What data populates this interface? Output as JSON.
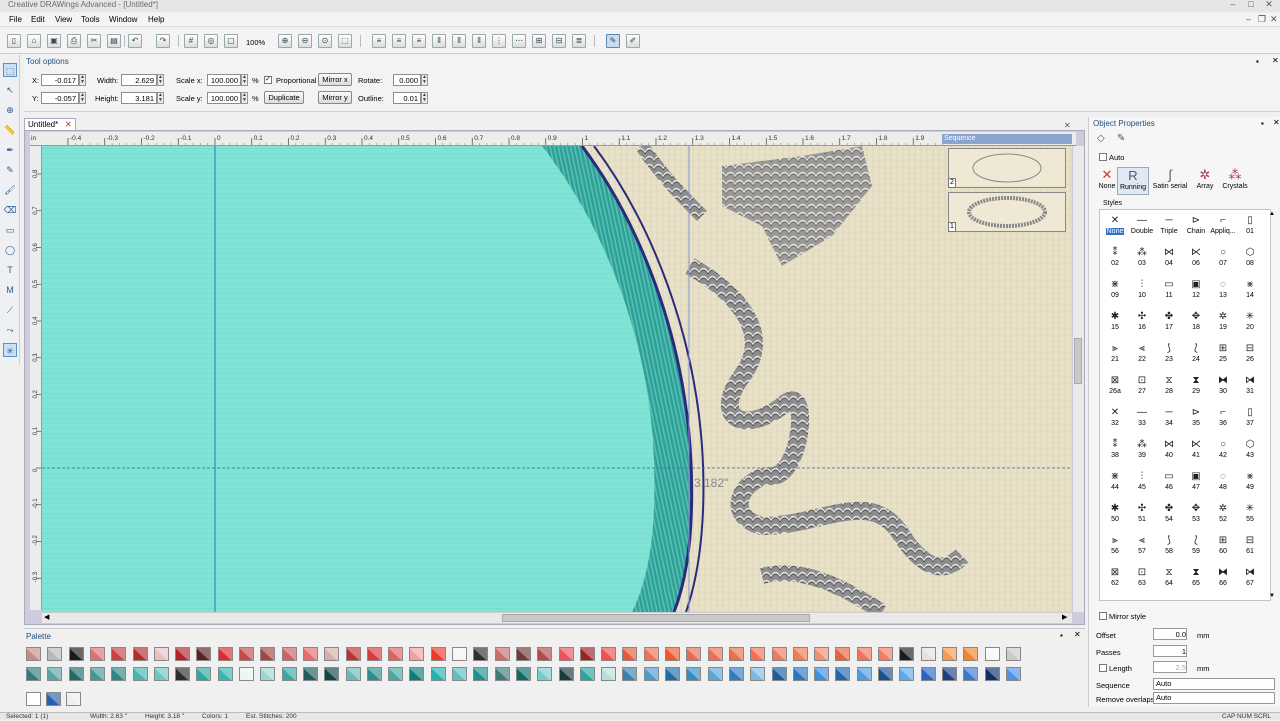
{
  "window": {
    "title": "Creative DRAWings Advanced - [Untitled*]"
  },
  "menu": [
    "File",
    "Edit",
    "View",
    "Tools",
    "Window",
    "Help"
  ],
  "toolbar": {
    "zoom": "100%"
  },
  "tool_options": {
    "header": "Tool options",
    "x_label": "X:",
    "x_value": "-0.017",
    "y_label": "Y:",
    "y_value": "-0.057",
    "width_label": "Width:",
    "width_value": "2.629",
    "height_label": "Height:",
    "height_value": "3.181",
    "scalex_label": "Scale x:",
    "scalex_value": "100.000",
    "scaley_label": "Scale y:",
    "scaley_value": "100.000",
    "percent": "%",
    "proportional_label": "Proportional",
    "duplicate_label": "Duplicate",
    "mirrorx_label": "Mirror x",
    "mirrory_label": "Mirror y",
    "rotate_label": "Rotate:",
    "rotate_value": "0.000",
    "outline_label": "Outline:",
    "outline_value": "0.01"
  },
  "document": {
    "tab_label": "Untitled*",
    "measure_label": "3.182\""
  },
  "ruler": {
    "unit": "in",
    "h_ticks": [
      "-0.4",
      "-0.3",
      "-0.2",
      "-0.1",
      "0",
      "0.1",
      "0.2",
      "0.3",
      "0.4",
      "0.5",
      "0.6",
      "0.7",
      "0.8",
      "0.9",
      "1",
      "1.1",
      "1.2",
      "1.3",
      "1.4",
      "1.5",
      "1.6",
      "1.7",
      "1.8",
      "1.9"
    ],
    "v_ticks": [
      "0.8",
      "0.7",
      "0.6",
      "0.5",
      "0.4",
      "0.3",
      "0.2",
      "0.1",
      "0",
      "-0.1",
      "-0.2",
      "-0.3"
    ]
  },
  "sequence": {
    "header": "Sequence",
    "items": [
      "2",
      "1"
    ]
  },
  "object_properties": {
    "header": "Object Properties",
    "auto_label": "Auto",
    "modes": [
      {
        "label": "None",
        "icon": "x-icon"
      },
      {
        "label": "Running",
        "icon": "running-icon"
      },
      {
        "label": "Satin serial",
        "icon": "satin-icon"
      },
      {
        "label": "Array",
        "icon": "array-icon"
      },
      {
        "label": "Crystals",
        "icon": "crystals-icon"
      }
    ],
    "styles_label": "Styles",
    "styles": [
      "None",
      "Double",
      "Triple",
      "Chain",
      "Appliq...",
      "01",
      "02",
      "03",
      "04",
      "06",
      "07",
      "08",
      "09",
      "10",
      "11",
      "12",
      "13",
      "14",
      "15",
      "16",
      "17",
      "18",
      "19",
      "20",
      "21",
      "22",
      "23",
      "24",
      "25",
      "26",
      "26a",
      "27",
      "28",
      "29",
      "30",
      "31",
      "32",
      "33",
      "34",
      "35",
      "36",
      "37",
      "38",
      "39",
      "40",
      "41",
      "42",
      "43",
      "44",
      "45",
      "46",
      "47",
      "48",
      "49",
      "50",
      "51",
      "54",
      "53",
      "52",
      "55",
      "56",
      "57",
      "58",
      "59",
      "60",
      "61",
      "62",
      "63",
      "64",
      "65",
      "66",
      "67"
    ],
    "mirror_style_label": "Mirror style",
    "offset_label": "Offset",
    "offset_value": "0.0",
    "passes_label": "Passes",
    "passes_value": "1",
    "length_label": "Length",
    "length_value": "2.5",
    "unit_mm": "mm",
    "sequence_label": "Sequence",
    "sequence_value": "Auto",
    "remove_overlaps_label": "Remove overlaps",
    "remove_overlaps_value": "Auto"
  },
  "palette": {
    "header": "Palette",
    "row1": [
      "#c98a8a",
      "#b9b9b9",
      "#1a1a1a",
      "#e07070",
      "#c84040",
      "#b52a2a",
      "#e8c0c0",
      "#b3242a",
      "#5c1f24",
      "#e0282e",
      "#c74a4a",
      "#a64444",
      "#d06060",
      "#e86b6b",
      "#d4b0a8",
      "#c03030",
      "#d83b3b",
      "#e06060",
      "#f0a0a0",
      "#ee3a2c",
      "#f5f5f5",
      "#2e2e2e",
      "#c96c6c",
      "#6e3a3a",
      "#b44a4a",
      "#e8555f",
      "#a02020",
      "#f05050",
      "#e45a3a",
      "#f07050",
      "#f3552b",
      "#e86a55",
      "#ee6e50",
      "#e8704a",
      "#f56f52",
      "#f07a5a",
      "#ef7c52",
      "#f08f6f",
      "#e7623b",
      "#f0725a",
      "#f27c60",
      "#1c1c1c",
      "#e9e0d8",
      "#f39a4e",
      "#f2842a",
      "#f7f7f7",
      "#c9c9c9"
    ],
    "row2": [
      "#2f7d78",
      "#5aa5a2",
      "#1e6b67",
      "#3f9a94",
      "#2f8884",
      "#48b7ae",
      "#6cc7c0",
      "#2c2c2c",
      "#2ca8a2",
      "#34b8b0",
      "#e8f6f5",
      "#9ed7d2",
      "#3aa8a0",
      "#1d5c58",
      "#0f4644",
      "#6abab6",
      "#2b8e8a",
      "#47a9a3",
      "#0e7d7a",
      "#27b2ad",
      "#5ebfbc",
      "#1a928e",
      "#3d7b79",
      "#0a6b66",
      "#78cdc8",
      "#1a3a39",
      "#2aa6a0",
      "#b6dfdc",
      "#3a7fb0",
      "#4a9bd0",
      "#1f6ca6",
      "#3789c4",
      "#5aa6d9",
      "#2e7dbf",
      "#7eb8e0",
      "#155f9b",
      "#2a77c0",
      "#3c8ee0",
      "#2065a8",
      "#4d9ce0",
      "#1d4f8a",
      "#5eaae8",
      "#2a66c0",
      "#1c3f80",
      "#3a78d0",
      "#0f2e66",
      "#5090e8"
    ]
  },
  "statusbar": {
    "selected": "Selected: 1 (1)",
    "width": "Width: 2.63 \"",
    "height": "Height: 3.18 \"",
    "colors": "Colors: 1",
    "stitches": "Est. Stitches: 200",
    "right": "CAP  NUM  SCRL"
  },
  "colors": {
    "fill": "#7ee3d6",
    "satin_outer": "#2b9e95",
    "border_dark": "#2a2a7a",
    "fabric": "#e9e2c9"
  }
}
